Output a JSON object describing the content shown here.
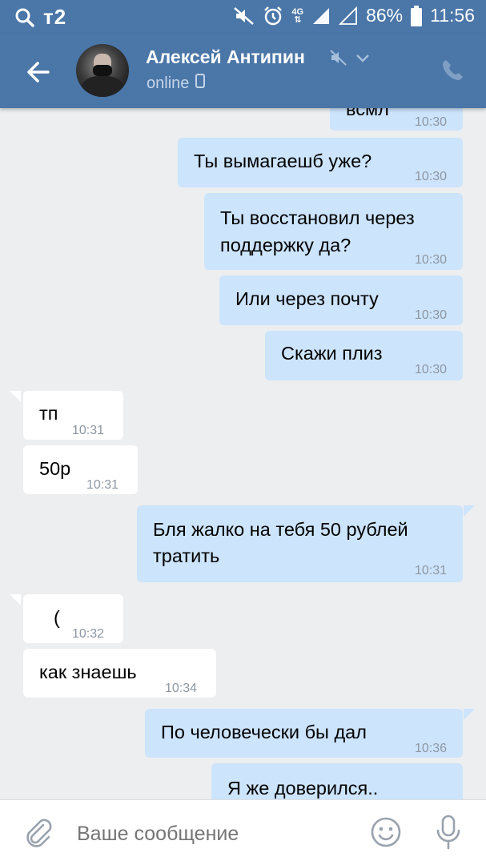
{
  "status_bar": {
    "carrier": "т2",
    "battery": "86%",
    "time": "11:56",
    "net_label": "4G",
    "icons": [
      "search-icon",
      "mute-icon",
      "alarm-icon",
      "signal-icon",
      "battery-icon"
    ]
  },
  "header": {
    "contact_name": "Алексей Антипин",
    "status": "online",
    "icons": [
      "back-arrow-icon",
      "muted-speaker-icon",
      "chevron-down-icon",
      "mobile-icon",
      "phone-icon"
    ]
  },
  "messages": [
    {
      "dir": "out",
      "text": "всмл",
      "time": "10:30"
    },
    {
      "dir": "out",
      "text": "Ты вымагаешб уже?",
      "time": "10:30"
    },
    {
      "dir": "out",
      "line1": "Ты восстановил через",
      "line2": "поддержку да?",
      "time": "10:30"
    },
    {
      "dir": "out",
      "text": "Или через почту",
      "time": "10:30"
    },
    {
      "dir": "out",
      "text": "Скажи плиз",
      "time": "10:30"
    },
    {
      "dir": "in",
      "text": "тп",
      "time": "10:31"
    },
    {
      "dir": "in",
      "text": "50р",
      "time": "10:31"
    },
    {
      "dir": "out",
      "line1": "Бля жалко на тебя 50 рублей",
      "line2": "тратить",
      "time": "10:31"
    },
    {
      "dir": "in",
      "text": "(",
      "time": "10:32"
    },
    {
      "dir": "in",
      "text": "как знаешь",
      "time": "10:34"
    },
    {
      "dir": "out",
      "text": "По человечески бы дал",
      "time": "10:36"
    },
    {
      "dir": "out",
      "text": "Я же доверился..",
      "time": "10:36"
    }
  ],
  "composer": {
    "placeholder": "Ваше сообщение",
    "icons": [
      "attach-icon",
      "emoji-icon",
      "microphone-icon"
    ]
  },
  "colors": {
    "header": "#4a76a8",
    "outgoing_bubble": "#cce4fc",
    "incoming_bubble": "#ffffff",
    "background": "#edeef0",
    "time_text": "#8d97a3"
  }
}
